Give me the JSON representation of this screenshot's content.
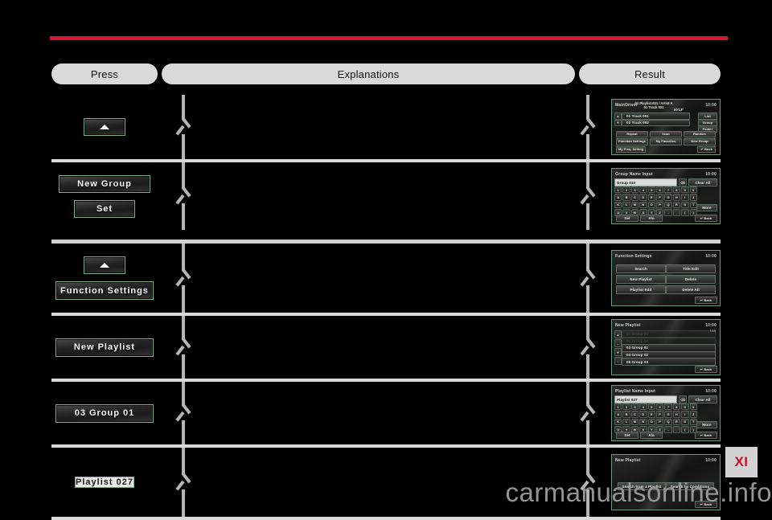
{
  "chapter_tab": "XI",
  "watermark": "carmanualsonline.info",
  "header": {
    "press": "Press",
    "explanations": "Explanations",
    "result": "Result"
  },
  "sections": [
    {
      "rows": [
        {
          "press_buttons": [
            {
              "label": "",
              "icon": "chevron-up-icon",
              "style": "up"
            }
          ],
          "result": {
            "kind": "player",
            "title": "MainDriver",
            "clock": "10:00",
            "now_playing_1": "01 Playlist 001 / Artist A",
            "now_playing_2": "01 Track 001",
            "time": "00'13\"",
            "side_buttons": [
              "List",
              "Group",
              "Folder"
            ],
            "tracks": [
              "01  Track 001",
              "02  Track 002"
            ],
            "menu": [
              "Repeat",
              "Scan",
              "Random",
              "Function Settings",
              "My Favorites",
              "New Group",
              "My Freq. Setting"
            ],
            "back": "Back"
          }
        },
        {
          "press_buttons": [
            {
              "label": "New Group",
              "icon": "",
              "style": "wide2"
            },
            {
              "label": "Set",
              "icon": "",
              "style": "set"
            }
          ],
          "result": {
            "kind": "keyboard",
            "title": "Group Name Input",
            "clock": "10:00",
            "field_value": "Group 010",
            "clear_all": "Clear All",
            "back_key": "⌫",
            "keys": [
              [
                "1",
                "2",
                "3",
                "4",
                "5",
                "6",
                "7",
                "8",
                "9",
                "0"
              ],
              [
                "A",
                "B",
                "C",
                "D",
                "E",
                "F",
                "G",
                "H",
                "I",
                "J"
              ],
              [
                "K",
                "L",
                "M",
                "N",
                "O",
                "P",
                "Q",
                "R",
                "S",
                "T"
              ],
              [
                "U",
                "V",
                "W",
                "X",
                "Y",
                "Z",
                "-",
                "_",
                "(",
                ")"
              ]
            ],
            "more": "More",
            "set": "Set",
            "case": "A/a",
            "back": "Back"
          }
        }
      ]
    },
    {
      "rows": [
        {
          "press_buttons": [
            {
              "label": "",
              "icon": "chevron-up-icon",
              "style": "up"
            },
            {
              "label": "Function Settings",
              "icon": "",
              "style": "wide3"
            }
          ],
          "result": {
            "kind": "menu2col",
            "title": "Function Settings",
            "clock": "10:00",
            "items_left": [
              "Search",
              "New Playlist",
              "Playlist Edit"
            ],
            "items_right": [
              "Title Edit",
              "Delete",
              "Delete All"
            ],
            "back": "Back"
          }
        },
        {
          "press_buttons": [
            {
              "label": "New Playlist",
              "icon": "",
              "style": "wide3"
            }
          ],
          "result": {
            "kind": "list",
            "title": "New Playlist",
            "clock": "10:00",
            "page": "1/15",
            "items": [
              "01  Group 00",
              "02  Group 00",
              "03  Group 01",
              "04  Group 02",
              "05  Group 03"
            ],
            "back": "Back"
          }
        },
        {
          "press_buttons": [
            {
              "label": "03   Group 01",
              "icon": "",
              "style": "wide3"
            }
          ],
          "result": {
            "kind": "keyboard",
            "title": "Playlist Name Input",
            "clock": "10:00",
            "field_value": "Playlist 027",
            "clear_all": "Clear All",
            "back_key": "⌫",
            "keys": [
              [
                "1",
                "2",
                "3",
                "4",
                "5",
                "6",
                "7",
                "8",
                "9",
                "0"
              ],
              [
                "A",
                "B",
                "C",
                "D",
                "E",
                "F",
                "G",
                "H",
                "I",
                "J"
              ],
              [
                "K",
                "L",
                "M",
                "N",
                "O",
                "P",
                "Q",
                "R",
                "S",
                "T"
              ],
              [
                "U",
                "V",
                "W",
                "X",
                "Y",
                "Z",
                "-",
                "_",
                "(",
                ")"
              ]
            ],
            "more": "More",
            "set": "Set",
            "case": "A/a",
            "back": "Back"
          }
        },
        {
          "press_buttons": [
            {
              "label": "Playlist 027",
              "icon": "",
              "style": "light"
            }
          ],
          "result": {
            "kind": "twobtn",
            "title": "New Playlist",
            "clock": "10:00",
            "buttons": [
              "Search from a Playlist",
              "Search by Conditions"
            ],
            "back": "Back"
          }
        }
      ]
    }
  ]
}
